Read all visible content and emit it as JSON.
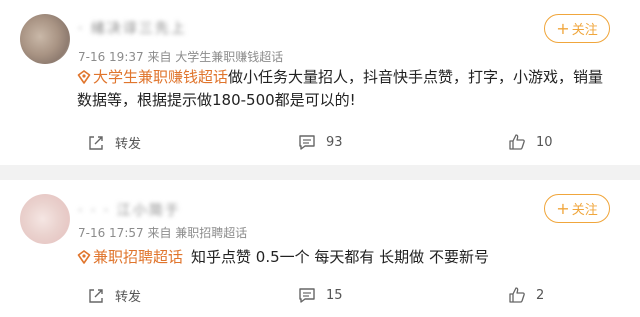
{
  "posts": [
    {
      "username": "· 绪决谆三先上",
      "time": "7-16 19:37",
      "source": "来自 大学生兼职赚钱超话",
      "follow_label": "关注",
      "topic": "大学生兼职赚钱超话",
      "text": "做小任务大量招人，抖音快手点赞，打字，小游戏，销量数据等，根据提示做180-500都是可以的!",
      "repost_label": "转发",
      "comments": "93",
      "likes": "10"
    },
    {
      "username": "· · · 江小简于",
      "time": "7-16 17:57",
      "source": "来自 兼职招聘超话",
      "follow_label": "关注",
      "topic": "兼职招聘超话",
      "text": "知乎点赞 0.5一个 每天都有 长期做 不要新号",
      "repost_label": "转发",
      "comments": "15",
      "likes": "2"
    }
  ],
  "colors": {
    "accent": "#f0a63c",
    "topic": "#e0752d",
    "separator": "#f2f2f2"
  },
  "icons": [
    "supertopic-icon",
    "repost-icon",
    "comment-icon",
    "like-icon"
  ]
}
